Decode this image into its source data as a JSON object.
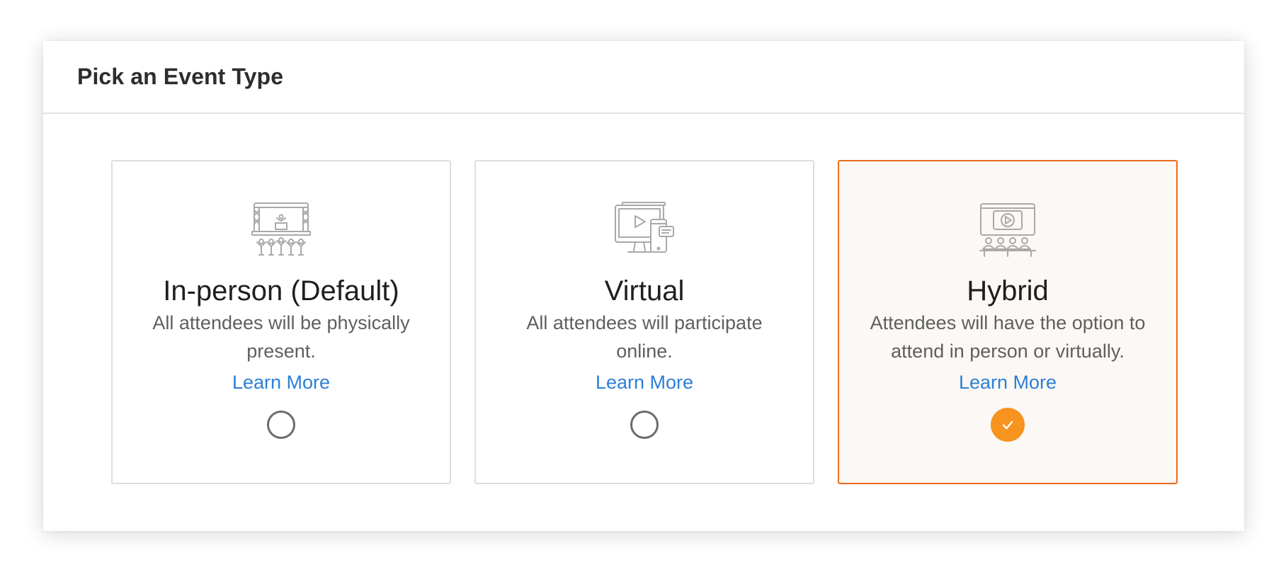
{
  "header": {
    "title": "Pick an Event Type"
  },
  "cards": [
    {
      "title": "In-person (Default)",
      "description": "All attendees will be physically present.",
      "link": "Learn More",
      "selected": false,
      "icon": "stage-audience-icon"
    },
    {
      "title": "Virtual",
      "description": "All attendees will participate online.",
      "link": "Learn More",
      "selected": false,
      "icon": "devices-video-icon"
    },
    {
      "title": "Hybrid",
      "description": "Attendees will have the option to attend in person or virtually.",
      "link": "Learn More",
      "selected": true,
      "icon": "screen-audience-icon"
    }
  ],
  "colors": {
    "accent_border": "#ec6c1f",
    "check_fill": "#f7931e",
    "link": "#2c7fd6",
    "selected_bg": "#fcf8f5"
  }
}
